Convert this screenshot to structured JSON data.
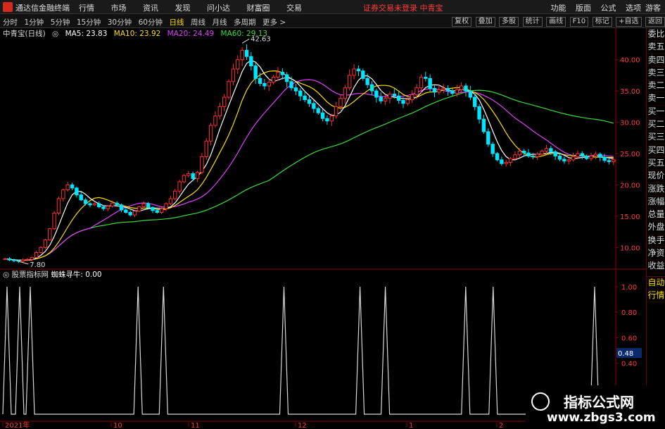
{
  "app": {
    "name": "通达信金融终端",
    "menu": [
      "行情",
      "市场",
      "资讯",
      "发现",
      "问小达",
      "财富圈",
      "交易"
    ],
    "promo": "证券交易未登录  中青宝",
    "right_menu": [
      "功能",
      "版面",
      "公式",
      "选项"
    ],
    "guest": "游客"
  },
  "periods": [
    "分时",
    "1分钟",
    "5分钟",
    "15分钟",
    "30分钟",
    "60分钟",
    "日线",
    "周线",
    "月线",
    "多周期",
    "更多 >"
  ],
  "active_period": "日线",
  "toolbar": [
    "复权",
    "叠加",
    "多股",
    "统计",
    "画线",
    "F10",
    "标记",
    "+自选",
    "返回"
  ],
  "legend": {
    "title": "中青宝(日线)",
    "ma5": "MA5: 23.83",
    "ma10": "MA10: 23.92",
    "ma20": "MA20: 24.49",
    "ma60": "MA60: 29.13",
    "colors": {
      "ma5": "#ffffff",
      "ma10": "#ffde00",
      "ma20": "#e040fb",
      "ma60": "#3ddc3d",
      "up": "#ff3030",
      "down": "#00e5ff",
      "indicator": "#d8d8d8"
    }
  },
  "indicator": {
    "name": "股票指标网",
    "label": "蜘蛛寻牛: 0.00",
    "current": "0.48",
    "spike_months": [
      "9",
      "9",
      "9",
      "10",
      "10",
      "11",
      "12",
      "1",
      "1",
      "2",
      "2"
    ]
  },
  "side_panel": {
    "items": [
      "委比",
      "卖五",
      "卖四",
      "卖三",
      "卖二",
      "卖一",
      "买一",
      "买二",
      "买三",
      "买四",
      "买五",
      "现价",
      "涨跌",
      "涨幅",
      "总量",
      "外盘",
      "换手",
      "净资",
      "收益"
    ],
    "bottom_items": [
      "自动",
      "行情"
    ]
  },
  "chart_data": [
    {
      "type": "candlestick",
      "title": "中青宝(日线)",
      "y_ticks": [
        "40.00",
        "35.00",
        "30.00",
        "25.00",
        "20.00",
        "15.00",
        "10.00"
      ],
      "ylim": [
        7,
        43
      ],
      "annotations": [
        {
          "label": "42.63",
          "value": 42.63
        },
        {
          "label": "7.80",
          "value": 7.8
        }
      ],
      "series": [
        {
          "name": "MA5",
          "color": "#ffffff"
        },
        {
          "name": "MA10",
          "color": "#ffde00"
        },
        {
          "name": "MA20",
          "color": "#e040fb"
        },
        {
          "name": "MA60",
          "color": "#3ddc3d"
        }
      ],
      "price_path": [
        8.2,
        8.0,
        7.9,
        7.8,
        8.0,
        8.1,
        8.4,
        9.2,
        10.0,
        11.2,
        13.0,
        15.5,
        17.8,
        19.2,
        20.0,
        19.5,
        18.4,
        17.6,
        17.0,
        16.8,
        17.0,
        16.5,
        16.2,
        16.6,
        17.1,
        16.8,
        16.0,
        15.6,
        15.2,
        15.8,
        16.5,
        17.0,
        16.4,
        15.9,
        15.6,
        16.2,
        17.0,
        17.8,
        19.0,
        20.5,
        21.5,
        21.8,
        21.0,
        22.0,
        24.5,
        27.0,
        29.5,
        31.0,
        32.5,
        34.0,
        36.5,
        38.5,
        40.0,
        41.5,
        40.5,
        39.0,
        37.0,
        36.2,
        35.8,
        36.4,
        37.2,
        38.0,
        37.6,
        36.5,
        35.5,
        35.0,
        34.2,
        33.6,
        33.0,
        32.2,
        31.5,
        30.6,
        30.2,
        31.0,
        32.5,
        33.8,
        35.5,
        37.5,
        38.5,
        38.2,
        37.0,
        36.0,
        35.0,
        34.0,
        33.4,
        33.8,
        34.5,
        34.2,
        33.5,
        33.0,
        33.6,
        34.4,
        35.5,
        37.2,
        37.0,
        35.4,
        34.8,
        35.2,
        35.4,
        35.0,
        34.6,
        35.2,
        35.8,
        35.0,
        34.0,
        32.5,
        30.5,
        28.5,
        26.5,
        25.0,
        24.0,
        23.4,
        23.6,
        24.2,
        24.8,
        25.4,
        25.1,
        24.6,
        24.5,
        24.9,
        25.4,
        25.8,
        25.3,
        24.6,
        24.1,
        23.8,
        24.0,
        24.5,
        25.0,
        24.6,
        24.2,
        24.6,
        24.9,
        24.4,
        23.9,
        23.7,
        24.0
      ]
    },
    {
      "type": "line",
      "title": "蜘蛛寻牛",
      "y_ticks": [
        "1.00",
        "0.80",
        "0.60",
        "0.40"
      ],
      "ylim": [
        0,
        1.05
      ],
      "x_ticks": [
        "2021年",
        "10",
        "11",
        "12",
        "1",
        "2"
      ],
      "spikes_at": [
        2,
        8,
        13,
        64,
        76,
        133,
        169,
        181,
        219,
        232,
        280
      ],
      "value": 0.48
    }
  ],
  "watermark": {
    "line1": "指标公式网",
    "line2": "www.zbgs3.com"
  }
}
